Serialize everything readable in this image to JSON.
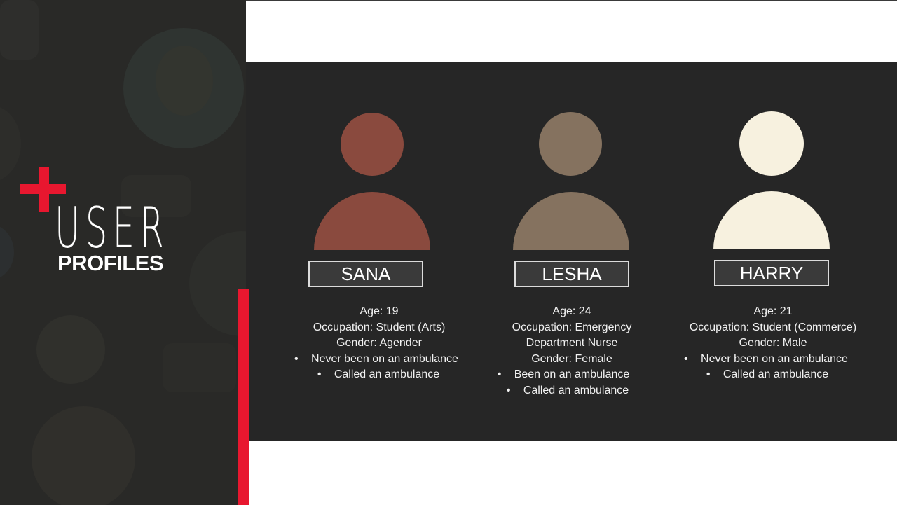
{
  "slide": {
    "title_line1": "USER",
    "title_line2": "PROFILES"
  },
  "colors": {
    "accent": "#e8172f",
    "panel": "#262626",
    "left_panel": "#292927"
  },
  "profiles": [
    {
      "name": "SANA",
      "avatar_color": "#8a4a3e",
      "age": "Age:  19",
      "occupation": "Occupation: Student (Arts)",
      "gender": "Gender: Agender",
      "bullets": [
        "Never been on an ambulance",
        "Called an ambulance"
      ]
    },
    {
      "name": "LESHA",
      "avatar_color": "#85725f",
      "age": "Age: 24",
      "occupation_line1": "Occupation: Emergency",
      "occupation_line2": "Department Nurse",
      "gender": "Gender:  Female",
      "bullets": [
        "Been on an ambulance",
        "Called an ambulance"
      ]
    },
    {
      "name": "HARRY",
      "avatar_color": "#f7f1df",
      "age": "Age: 21",
      "occupation": "Occupation: Student (Commerce)",
      "gender": "Gender:  Male",
      "bullets": [
        "Never been on an ambulance",
        "Called an ambulance"
      ]
    }
  ]
}
